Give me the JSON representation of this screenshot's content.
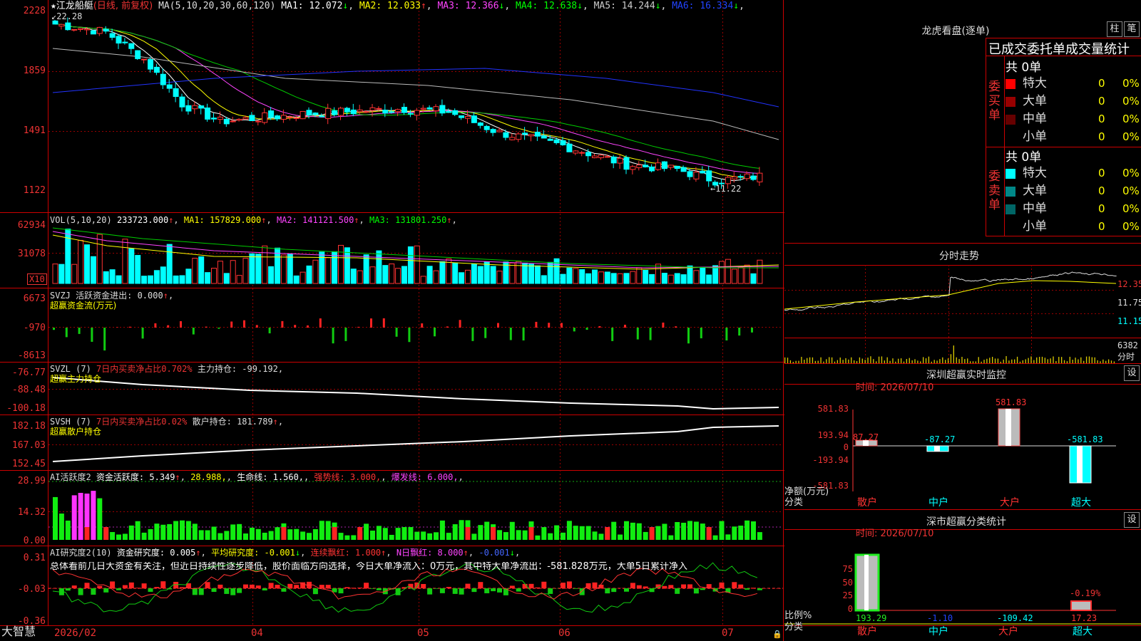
{
  "stock": {
    "name": "江龙船艇",
    "period": "(日线, 前复权)",
    "star": "★",
    "high_label": "22.28",
    "low_label": "11.22"
  },
  "ma_legend": [
    {
      "text": "MA(5,10,20,30,60,120)",
      "color": "#dddddd"
    },
    {
      "text": "MA1: 12.072",
      "arrow": "↓",
      "color": "#ffffff"
    },
    {
      "text": "MA2: 12.033",
      "arrow": "↑",
      "color": "#ffff00"
    },
    {
      "text": "MA3: 12.366",
      "arrow": "↓",
      "color": "#ff44ff"
    },
    {
      "text": "MA4: 12.638",
      "arrow": "↓",
      "color": "#00ff00"
    },
    {
      "text": "MA5: 14.244",
      "arrow": "↓",
      "color": "#cccccc"
    },
    {
      "text": "MA6: 16.334",
      "arrow": "↓",
      "color": "#2244ff"
    }
  ],
  "price_axis": [
    "2228",
    "1859",
    "1491",
    "1122"
  ],
  "volume": {
    "legend": [
      {
        "text": "VOL(5,10,20)",
        "color": "#dddddd"
      },
      {
        "text": "233723.000",
        "arrow": "↑",
        "color": "#ffffff"
      },
      {
        "text": "MA1: 157829.000",
        "arrow": "↑",
        "color": "#ffff00"
      },
      {
        "text": "MA2: 141121.500",
        "arrow": "↑",
        "color": "#ff44ff"
      },
      {
        "text": "MA3: 131801.250",
        "arrow": "↑",
        "color": "#00ff00"
      }
    ],
    "axis": [
      "62934",
      "31078"
    ],
    "unit": "X10"
  },
  "svzj": {
    "legend1": "SVZJ  活跃资金进出: 0.000",
    "legend1_arrow": "↑",
    "legend2": "超赢资金流(万元)",
    "axis": [
      "6673",
      "-970",
      "-8613"
    ]
  },
  "svzl": {
    "legend_a": "SVZL (7)",
    "legend_b": "7日内买卖净占比0.702%",
    "legend_c": "主力持仓: -99.192,",
    "legend2": "超赢主力持仓",
    "axis": [
      "-76.77",
      "-88.48",
      "-100.18"
    ]
  },
  "svsh": {
    "legend_a": "SVSH (7)",
    "legend_b": "7日内买卖净占比0.02%",
    "legend_c": "散户持仓: 181.789",
    "legend_c_arrow": "↑",
    "legend2": "超赢散户持仓",
    "axis": [
      "182.18",
      "167.03",
      "152.45"
    ]
  },
  "ai_active": {
    "legend": [
      {
        "text": "AI活跃度2",
        "color": "#dddddd"
      },
      {
        "text": "资金活跃度: 5.349",
        "arrow": "↑",
        "color": "#ffffff"
      },
      {
        "text": "28.988,",
        "color": "#ffff00"
      },
      {
        "text": "生命线: 1.560,",
        "color": "#ffffff"
      },
      {
        "text": "强势线: 3.000,",
        "color": "#ff3333"
      },
      {
        "text": "爆发线: 6.000,",
        "color": "#ff44ff"
      }
    ],
    "axis": [
      "28.99",
      "14.32",
      "0.00"
    ]
  },
  "ai_research": {
    "legend": [
      {
        "text": "AI研究度2(10)",
        "color": "#dddddd"
      },
      {
        "text": "资金研究度: 0.005",
        "arrow": "↑",
        "color": "#ffffff"
      },
      {
        "text": "平均研究度: -0.001",
        "arrow": "↓",
        "color": "#ffff00"
      },
      {
        "text": "连续飘红: 1.000",
        "arrow": "↑",
        "color": "#ff3333"
      },
      {
        "text": "N日飘红: 8.000",
        "arrow": "↑",
        "color": "#ff44ff"
      },
      {
        "text": "-0.001",
        "arrow": "↓",
        "color": "#4466ff"
      }
    ],
    "comment": "总体看前几日大资金有关注，但近日持续性逐步降低，股价面临方向选择，今日大单净流入：0万元，其中特大单净流出：-581.828万元，大单5日累计净入",
    "axis": [
      "0.31",
      "-0.03",
      "-0.36"
    ]
  },
  "time_axis": {
    "brand": "大智慧",
    "labels": [
      "2026/02",
      "04",
      "05",
      "06",
      "07"
    ]
  },
  "lhkp": {
    "title": "龙虎看盘(逐单)",
    "btn1": "柱",
    "btn2": "笔",
    "subtitle": "已成交委托单成交量统计",
    "buy_label": "委买单",
    "sell_label": "委卖单",
    "buy_total": "共 0单",
    "sell_total": "共 0单",
    "buy_rows": [
      {
        "name": "特大",
        "count": "0",
        "pct": "0%",
        "color": "#ff0000"
      },
      {
        "name": "大单",
        "count": "0",
        "pct": "0%",
        "color": "#990000"
      },
      {
        "name": "中单",
        "count": "0",
        "pct": "0%",
        "color": "#660000"
      },
      {
        "name": "小单",
        "count": "0",
        "pct": "0%",
        "color": "#000000"
      }
    ],
    "sell_rows": [
      {
        "name": "特大",
        "count": "0",
        "pct": "0%",
        "color": "#00ffff"
      },
      {
        "name": "大单",
        "count": "0",
        "pct": "0%",
        "color": "#008888"
      },
      {
        "name": "中单",
        "count": "0",
        "pct": "0%",
        "color": "#006666"
      },
      {
        "name": "小单",
        "count": "0",
        "pct": "0%",
        "color": "#000000"
      }
    ]
  },
  "intraday": {
    "title": "分时走势",
    "axis": [
      "12.35",
      "11.75",
      "11.15"
    ],
    "vol_label": "6382",
    "time_label": "分时"
  },
  "sz_monitor": {
    "title": "深圳超赢实时监控",
    "btn": "设",
    "date": "时间: 2026/07/10",
    "axis": [
      "581.83",
      "193.94",
      "0",
      "-193.94",
      "-581.83"
    ],
    "unit_label": "净额(万元)",
    "cat_label": "分类",
    "categories": [
      "散户",
      "中户",
      "大户",
      "超大"
    ],
    "values": [
      87.27,
      -87.27,
      581.83,
      -581.83
    ],
    "value_labels": [
      "87.27",
      "-87.27",
      "581.83",
      "-581.83"
    ]
  },
  "sz_stats": {
    "title": "深市超赢分类统计",
    "btn": "设",
    "date": "时间: 2026/07/10",
    "axis": [
      "75",
      "50",
      "25",
      "0"
    ],
    "unit_label": "比例%",
    "cat_label": "分类",
    "categories": [
      "散户",
      "中户",
      "大户",
      "超大"
    ],
    "value_labels": [
      "193.29",
      "-1.10",
      "-109.42",
      "17.23"
    ],
    "extra_label": "-0.19%"
  },
  "chart_data": {
    "type": "candlestick",
    "price_range": [
      1122,
      2228
    ],
    "high_label": "22.28",
    "low_label": "11.22",
    "time_labels": [
      "2026/02",
      "04",
      "05",
      "06",
      "07"
    ]
  }
}
